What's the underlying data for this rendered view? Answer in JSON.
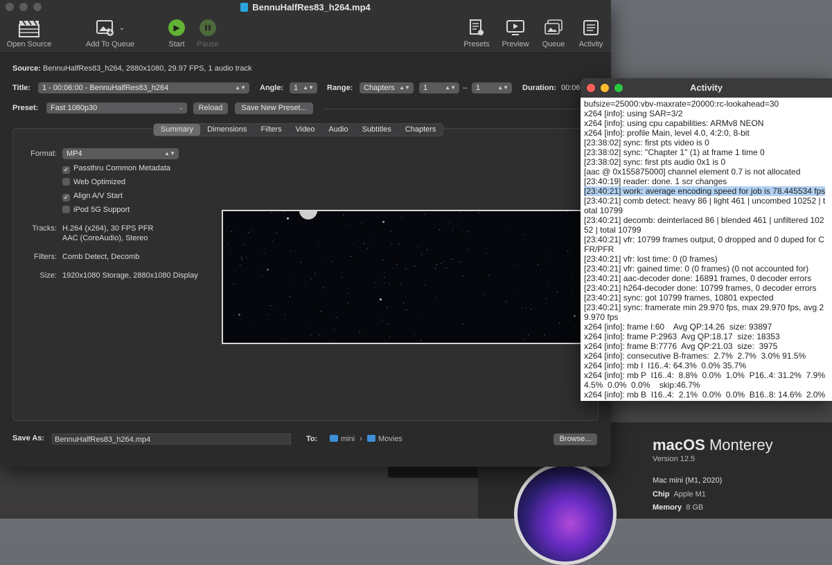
{
  "window": {
    "title": "BennuHalfRes83_h264.mp4"
  },
  "toolbar": {
    "open_source": "Open Source",
    "add_to_queue": "Add To Queue",
    "start": "Start",
    "pause": "Pause",
    "presets": "Presets",
    "preview": "Preview",
    "queue": "Queue",
    "activity": "Activity"
  },
  "source": {
    "label": "Source:",
    "value": "BennuHalfRes83_h264, 2880x1080, 29.97 FPS, 1 audio track"
  },
  "title_row": {
    "title_label": "Title:",
    "title_value": "1 - 00:06:00 - BennuHalfRes83_h264",
    "angle_label": "Angle:",
    "angle_value": "1",
    "range_label": "Range:",
    "range_type": "Chapters",
    "range_from": "1",
    "range_dash": "–",
    "range_to": "1",
    "duration_label": "Duration:",
    "duration_value": "00:06"
  },
  "preset_row": {
    "label": "Preset:",
    "value": "Fast 1080p30",
    "reload": "Reload",
    "save_new": "Save New Preset..."
  },
  "tabs": [
    "Summary",
    "Dimensions",
    "Filters",
    "Video",
    "Audio",
    "Subtitles",
    "Chapters"
  ],
  "summary": {
    "format_label": "Format:",
    "format_value": "MP4",
    "checkboxes": [
      {
        "label": "Passthru Common Metadata",
        "checked": true
      },
      {
        "label": "Web Optimized",
        "checked": false
      },
      {
        "label": "Align A/V Start",
        "checked": true
      },
      {
        "label": "iPod 5G Support",
        "checked": false
      }
    ],
    "tracks_label": "Tracks:",
    "tracks_line1": "H.264 (x264), 30 FPS PFR",
    "tracks_line2": "AAC (CoreAudio), Stereo",
    "filters_label": "Filters:",
    "filters_value": "Comb Detect, Decomb",
    "size_label": "Size:",
    "size_value": "1920x1080 Storage, 2880x1080 Display"
  },
  "save": {
    "label": "Save As:",
    "filename": "BennuHalfRes83_h264.mp4",
    "to_label": "To:",
    "path_1": "mini",
    "path_sep": "›",
    "path_2": "Movies",
    "browse": "Browse..."
  },
  "activity": {
    "title": "Activity",
    "lines": [
      "bufsize=25000:vbv-maxrate=20000:rc-lookahead=30",
      "x264 [info]: using SAR=3/2",
      "x264 [info]: using cpu capabilities: ARMv8 NEON",
      "x264 [info]: profile Main, level 4.0, 4:2:0, 8-bit",
      "[23:38:02] sync: first pts video is 0",
      "[23:38:02] sync: \"Chapter 1\" (1) at frame 1 time 0",
      "[23:38:02] sync: first pts audio 0x1 is 0",
      "[aac @ 0x155875000] channel element 0.7 is not allocated",
      "[23:40:19] reader: done. 1 scr changes",
      "[23:40:21] work: average encoding speed for job is 78.445534 fps",
      "[23:40:21] comb detect: heavy 86 | light 461 | uncombed 10252 | total 10799",
      "[23:40:21] decomb: deinterlaced 86 | blended 461 | unfiltered 10252 | total 10799",
      "[23:40:21] vfr: 10799 frames output, 0 dropped and 0 duped for CFR/PFR",
      "[23:40:21] vfr: lost time: 0 (0 frames)",
      "[23:40:21] vfr: gained time: 0 (0 frames) (0 not accounted for)",
      "[23:40:21] aac-decoder done: 16891 frames, 0 decoder errors",
      "[23:40:21] h264-decoder done: 10799 frames, 0 decoder errors",
      "[23:40:21] sync: got 10799 frames, 10801 expected",
      "[23:40:21] sync: framerate min 29.970 fps, max 29.970 fps, avg 29.970 fps",
      "x264 [info]: frame I:60    Avg QP:14.26  size: 93897",
      "x264 [info]: frame P:2963  Avg QP:18.17  size: 18353",
      "x264 [info]: frame B:7776  Avg QP:21.03  size:  3975",
      "x264 [info]: consecutive B-frames:  2.7%  2.7%  3.0% 91.5%",
      "x264 [info]: mb I  I16..4: 64.3%  0.0% 35.7%",
      "x264 [info]: mb P  I16..4:  8.8%  0.0%  1.0%  P16..4: 31.2%  7.9%  4.5%  0.0%  0.0%    skip:46.7%",
      "x264 [info]: mb B  I16..4:  2.1%  0.0%  0.0%  B16..8: 14.6%  2.0%"
    ],
    "highlight_index": 9
  },
  "about": {
    "os_name": "macOS",
    "os_release": "Monterey",
    "version": "Version 12.5",
    "model": "Mac mini (M1, 2020)",
    "chip_label": "Chip",
    "chip_value": "Apple M1",
    "memory_label": "Memory",
    "memory_value": "8 GB"
  }
}
